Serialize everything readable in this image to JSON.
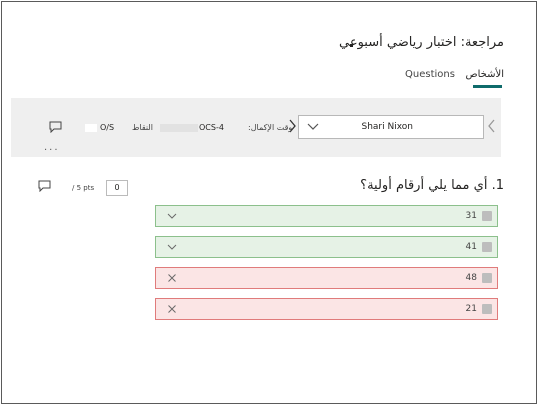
{
  "title": "مراجعة: اختبار رياضي أسبوعي",
  "tabs": {
    "people": "الأشخاص",
    "questions": "Questions"
  },
  "respondent": {
    "name": "Shari Nixon",
    "time_label": "وقت الإكمال:",
    "time_value": "OCS-4",
    "score_label": "النقاط",
    "score_value": "O/S"
  },
  "question": {
    "text": "1. أي مما يلي أرقام أولية؟",
    "points_value": "0",
    "points_suffix": "/ 5 pts",
    "options": [
      {
        "label": "31",
        "status": "correct"
      },
      {
        "label": "41",
        "status": "correct"
      },
      {
        "label": "48",
        "status": "wrong"
      },
      {
        "label": "21",
        "status": "wrong"
      }
    ]
  },
  "more_label": "...",
  "colors": {
    "accent": "#0f6b6b",
    "correct_bg": "#e6f2e6",
    "wrong_bg": "#fbe5e5"
  },
  "icons": [
    "comment-icon",
    "chevron-down-icon",
    "chevron-left-icon",
    "chevron-right-icon",
    "check-icon",
    "x-icon"
  ]
}
